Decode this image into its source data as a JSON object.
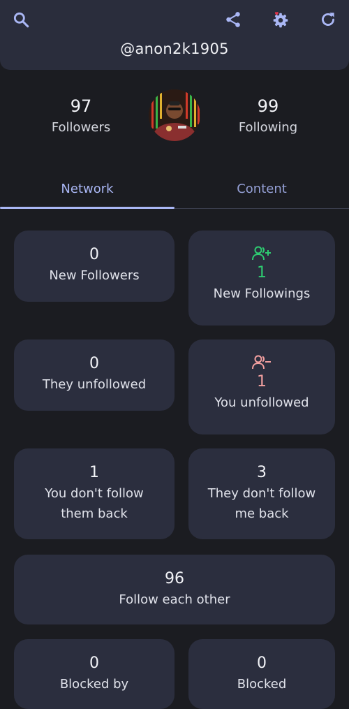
{
  "header": {
    "username": "@anon2k1905",
    "icons": [
      "search-icon",
      "share-icon",
      "settings-icon",
      "refresh-icon"
    ]
  },
  "profile": {
    "followers_count": "97",
    "followers_label": "Followers",
    "following_count": "99",
    "following_label": "Following"
  },
  "tabs": [
    {
      "label": "Network",
      "active": true
    },
    {
      "label": "Content",
      "active": false
    }
  ],
  "cards": {
    "new_followers": {
      "value": "0",
      "label": "New Followers"
    },
    "new_followings": {
      "value": "1",
      "label": "New Followings",
      "icon": "person-add-icon",
      "color": "#2ecc71"
    },
    "they_unfollowed": {
      "value": "0",
      "label": "They unfollowed"
    },
    "you_unfollowed": {
      "value": "1",
      "label": "You unfollowed",
      "icon": "person-remove-icon",
      "color": "#f3a0a0"
    },
    "you_dont_follow": {
      "value": "1",
      "line1": "You don't follow",
      "line2": "them back"
    },
    "they_dont_follow": {
      "value": "3",
      "line1": "They don't follow",
      "line2": "me back"
    },
    "follow_each_other": {
      "value": "96",
      "label": "Follow each other"
    },
    "blocked_by": {
      "value": "0",
      "label": "Blocked by"
    },
    "blocked": {
      "value": "0",
      "label": "Blocked"
    }
  },
  "colors": {
    "background": "#1b1c21",
    "card": "#2b2e3e",
    "accent": "#aab7f5",
    "green": "#2ecc71",
    "pink": "#f3a0a0",
    "badge": "#e0334a"
  }
}
